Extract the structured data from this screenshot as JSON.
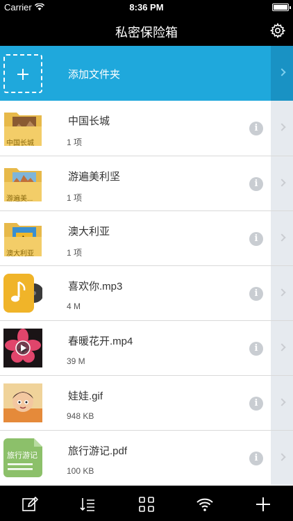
{
  "status": {
    "carrier": "Carrier",
    "time": "8:36 PM"
  },
  "nav": {
    "title": "私密保险箱",
    "settings_icon": "gear-icon"
  },
  "add_folder": {
    "label": "添加文件夹",
    "icon": "add-folder-icon"
  },
  "items": [
    {
      "name": "中国长城",
      "meta": "1 项",
      "thumb_type": "folder",
      "thumb_label": "中国长城"
    },
    {
      "name": "游遍美利坚",
      "meta": "1 项",
      "thumb_type": "folder",
      "thumb_label": "游遍美..."
    },
    {
      "name": "澳大利亚",
      "meta": "1 项",
      "thumb_type": "folder",
      "thumb_label": "澳大利亚"
    },
    {
      "name": "喜欢你.mp3",
      "meta": "4 M",
      "thumb_type": "audio",
      "thumb_label": ""
    },
    {
      "name": "春暖花开.mp4",
      "meta": "39 M",
      "thumb_type": "video",
      "thumb_label": ""
    },
    {
      "name": "娃娃.gif",
      "meta": "948 KB",
      "thumb_type": "gif",
      "thumb_label": ""
    },
    {
      "name": "旅行游记.pdf",
      "meta": "100 KB",
      "thumb_type": "pdf",
      "thumb_label": "旅行游记"
    }
  ],
  "info_glyph": "i",
  "toolbar": [
    {
      "icon": "edit-icon"
    },
    {
      "icon": "sort-icon"
    },
    {
      "icon": "grid-icon"
    },
    {
      "icon": "wifi-icon"
    },
    {
      "icon": "add-icon"
    }
  ],
  "colors": {
    "accent": "#1fa8dc",
    "bar_background": "#000000",
    "strip": "#e6eaef",
    "info": "#c9cdd2"
  }
}
